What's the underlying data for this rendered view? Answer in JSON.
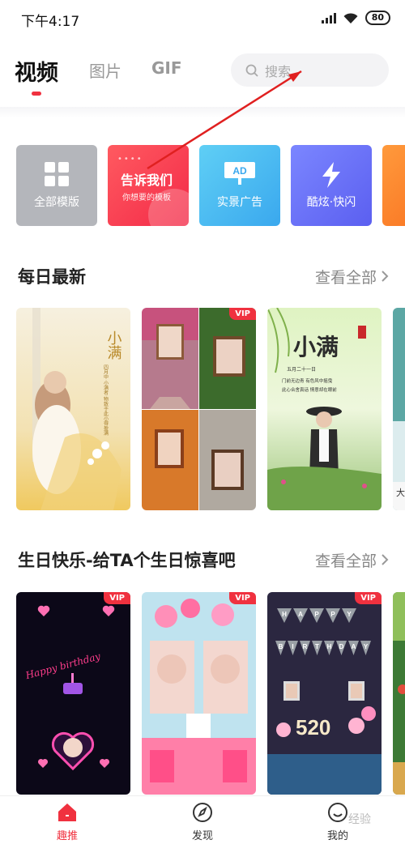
{
  "status": {
    "time": "下午4:17",
    "battery": "80"
  },
  "nav": {
    "tabs": [
      "视频",
      "图片",
      "GIF"
    ],
    "search_placeholder": "搜索"
  },
  "categories": [
    {
      "label": "全部模版"
    },
    {
      "title": "告诉我们",
      "subtitle": "你想要的模板"
    },
    {
      "label": "实景广告",
      "badge": "AD"
    },
    {
      "label": "酷炫·快闪"
    }
  ],
  "sections": [
    {
      "title": "每日最新",
      "see_all": "查看全部"
    },
    {
      "title": "生日快乐-给TA个生日惊喜吧",
      "see_all": "查看全部"
    }
  ],
  "cards_row1": {
    "c1_title": "小满",
    "c1_verse": "四月中 小满者 物致于此小得盈满",
    "c2_vip": "VIP",
    "c3_title": "小满",
    "c3_date": "五月二十一日",
    "c3_verse1": "门前无边青 有色风中摇曳",
    "c3_verse2": "此心合舍真话 情意却在眼前",
    "c4_text": "大"
  },
  "cards_row2": {
    "c1_vip": "VIP",
    "c1_text": "Happy birthday",
    "c2_vip": "VIP",
    "c3_vip": "VIP",
    "c3_letters": [
      "H",
      "A",
      "P",
      "P",
      "Y",
      "B",
      "I",
      "R",
      "T",
      "H",
      "D",
      "A",
      "Y"
    ],
    "c3_number": "520"
  },
  "bottom_nav": [
    {
      "label": "趣推"
    },
    {
      "label": "发现"
    },
    {
      "label": "我的"
    }
  ],
  "watermark": "经验",
  "colors": {
    "accent": "#f0313f",
    "annotation": "#e02020"
  }
}
